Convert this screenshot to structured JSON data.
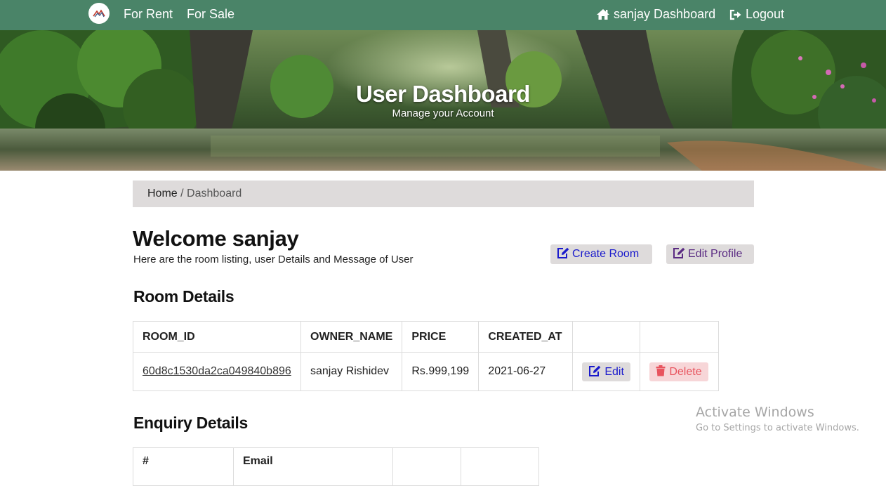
{
  "nav": {
    "for_rent": "For Rent",
    "for_sale": "For Sale",
    "dashboard": "sanjay Dashboard",
    "logout": "Logout",
    "color": "#4a8468"
  },
  "hero": {
    "title": "User Dashboard",
    "subtitle": "Manage your Account"
  },
  "breadcrumb": {
    "home": "Home",
    "separator": "/",
    "current": "Dashboard"
  },
  "welcome": {
    "title": "Welcome sanjay",
    "subtitle": "Here are the room listing, user Details and Message of User",
    "create_room": "Create Room",
    "edit_profile": "Edit Profile"
  },
  "room_details": {
    "heading": "Room Details",
    "columns": [
      "ROOM_ID",
      "OWNER_NAME",
      "PRICE",
      "CREATED_AT",
      "",
      ""
    ],
    "rows": [
      {
        "room_id": "60d8c1530da2ca049840b896",
        "owner_name": "sanjay Rishidev",
        "price": "Rs.999,199",
        "created_at": "2021-06-27",
        "edit_label": "Edit",
        "delete_label": "Delete"
      }
    ]
  },
  "enquiry_details": {
    "heading": "Enquiry Details",
    "columns": [
      "#",
      "Email",
      "",
      ""
    ]
  },
  "watermark": {
    "title": "Activate Windows",
    "subtitle": "Go to Settings to activate Windows."
  }
}
